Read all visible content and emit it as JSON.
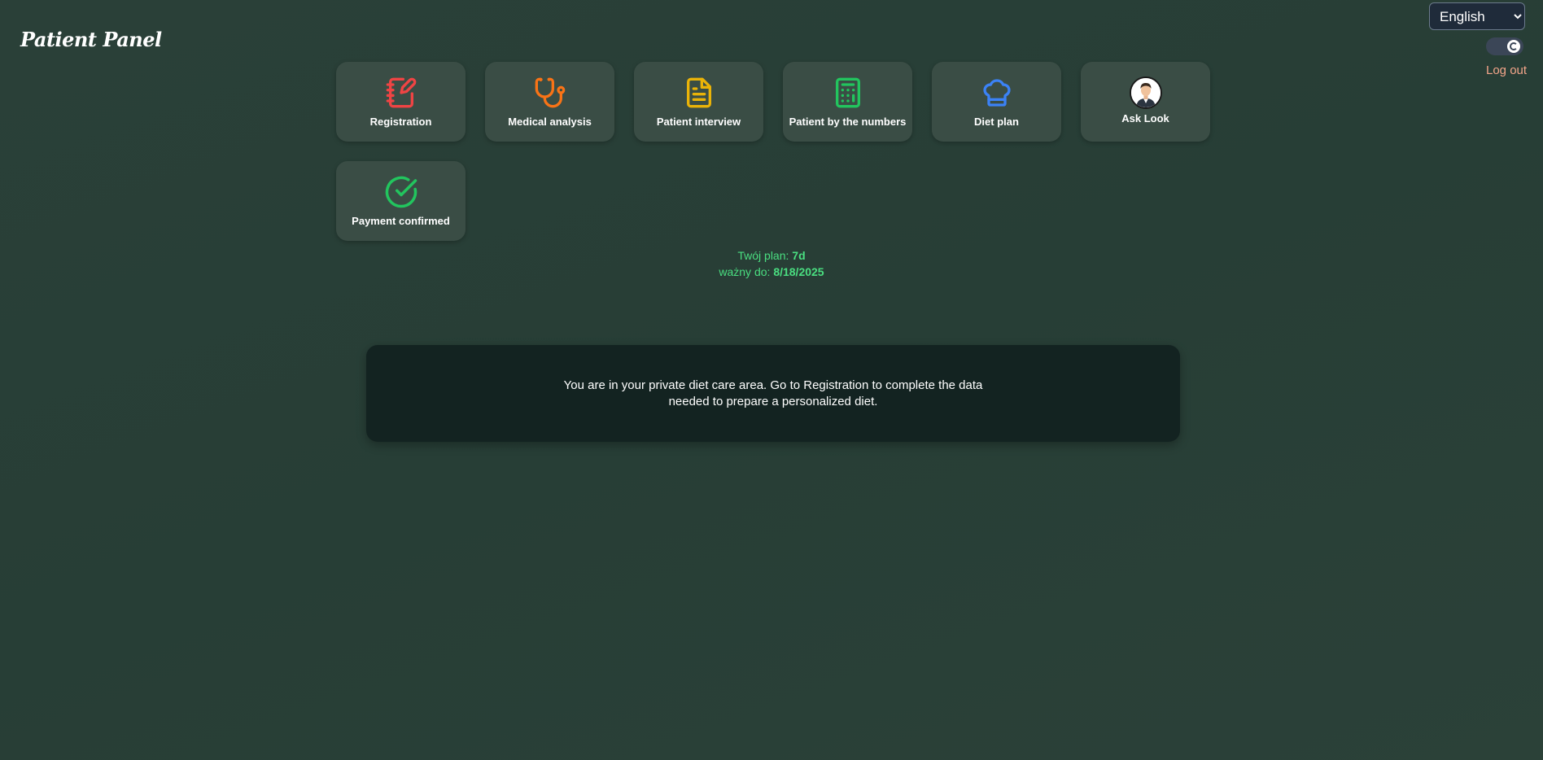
{
  "header": {
    "brand": "Patient Panel",
    "language": {
      "selected": "English",
      "options": [
        "English"
      ]
    },
    "logout_label": "Log out"
  },
  "tiles": [
    {
      "label": "Registration",
      "icon": "notebook-pen-icon",
      "color": "#ef4444"
    },
    {
      "label": "Medical analysis",
      "icon": "stethoscope-icon",
      "color": "#f97316"
    },
    {
      "label": "Patient interview",
      "icon": "document-icon",
      "color": "#eab308"
    },
    {
      "label": "Patient by the numbers",
      "icon": "calculator-icon",
      "color": "#22c55e"
    },
    {
      "label": "Diet plan",
      "icon": "chef-hat-icon",
      "color": "#3b82f6"
    },
    {
      "label": "Ask Look",
      "icon": "avatar"
    },
    {
      "label": "Payment confirmed",
      "icon": "check-circle-icon",
      "color": "#22c55e"
    }
  ],
  "plan": {
    "plan_prefix": "Twój plan: ",
    "plan_value": "7d",
    "valid_prefix": "ważny do: ",
    "valid_value": "8/18/2025"
  },
  "info": {
    "message": "You are in your private diet care area. Go to Registration to complete the data needed to prepare a personalized diet."
  },
  "colors": {
    "accent_green": "#4ade80",
    "logout": "#f3a58a"
  }
}
